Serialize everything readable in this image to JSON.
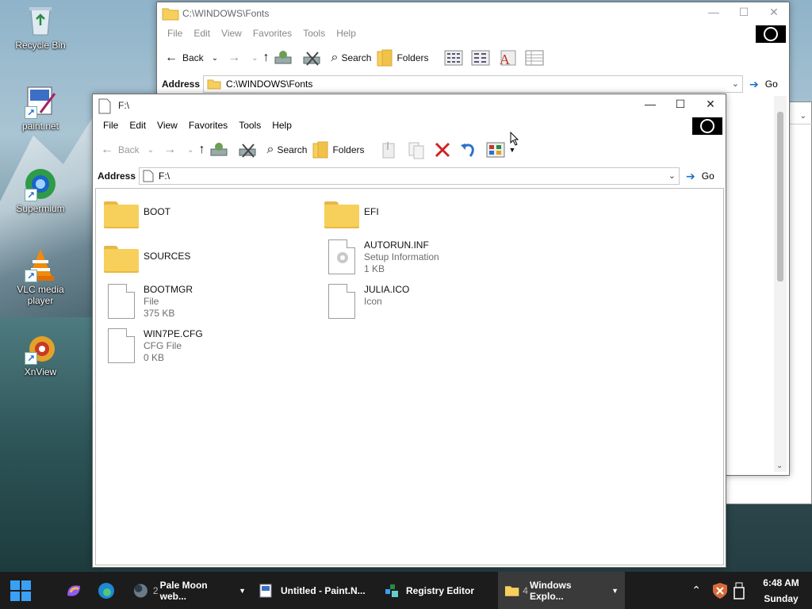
{
  "desktop": {
    "icons": [
      {
        "label": "Recycle Bin",
        "icon": "recycle-bin-icon"
      },
      {
        "label": "paint.net",
        "icon": "paint-net-icon"
      },
      {
        "label": "Supermium",
        "icon": "supermium-icon"
      },
      {
        "label": "VLC media player",
        "icon": "vlc-icon"
      },
      {
        "label": "XnView",
        "icon": "xnview-icon"
      }
    ]
  },
  "back_window": {
    "title": "C:\\WINDOWS\\Fonts",
    "menu": [
      "File",
      "Edit",
      "View",
      "Favorites",
      "Tools",
      "Help"
    ],
    "toolbar": {
      "back": "Back",
      "search": "Search",
      "folders": "Folders"
    },
    "address_label": "Address",
    "address_value": "C:\\WINDOWS\\Fonts",
    "go": "Go"
  },
  "front_window": {
    "title": "F:\\",
    "menu": [
      "File",
      "Edit",
      "View",
      "Favorites",
      "Tools",
      "Help"
    ],
    "toolbar": {
      "back": "Back",
      "search": "Search",
      "folders": "Folders"
    },
    "address_label": "Address",
    "address_value": "F:\\",
    "go": "Go",
    "items": [
      {
        "name": "BOOT",
        "type": "folder"
      },
      {
        "name": "EFI",
        "type": "folder"
      },
      {
        "name": "SOURCES",
        "type": "folder"
      },
      {
        "name": "AUTORUN.INF",
        "type": "setup-file",
        "desc": "Setup Information",
        "size": "1 KB"
      },
      {
        "name": "BOOTMGR",
        "type": "file",
        "desc": "File",
        "size": "375 KB"
      },
      {
        "name": "JULIA.ICO",
        "type": "file",
        "desc": "Icon"
      },
      {
        "name": "WIN7PE.CFG",
        "type": "file",
        "desc": "CFG File",
        "size": "0 KB"
      }
    ]
  },
  "taskbar": {
    "tasks": [
      {
        "count": "2",
        "label": "Pale Moon web...",
        "icon": "pale-moon-icon"
      },
      {
        "label": "Untitled - Paint.N...",
        "icon": "paint-net-icon"
      },
      {
        "label": "Registry Editor",
        "icon": "registry-editor-icon"
      },
      {
        "count": "4",
        "label": "Windows Explo...",
        "icon": "folder-icon"
      }
    ],
    "time": "6:48 AM",
    "day": "Sunday"
  },
  "colors": {
    "taskbar": "#1c1c1c",
    "folder": "#f7cf5b",
    "accent": "#1a6fd1"
  }
}
